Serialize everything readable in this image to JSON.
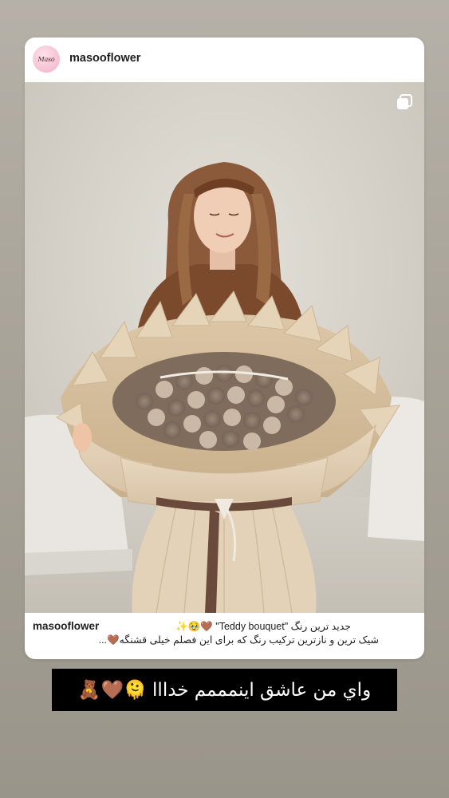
{
  "post": {
    "username": "masooflower",
    "avatar_logo": "Maso",
    "image_description": "Woman in brown shirt holding a large beige bouquet filled with teddy bears",
    "caption_user": "masooflower",
    "caption_line1": "جدید ترین رنگ \"Teddy bouquet\" 🤎🥹✨",
    "caption_line2": "شیک ترین و نازترین ترکیب رنگ که برای این فصلم خیلی قشنگه🤎..."
  },
  "sticker": {
    "text": "واي من عاشق اينمممم خدااا 🫠🤎🧸"
  },
  "colors": {
    "background": "#a8a398",
    "card": "#ffffff",
    "avatar_bg": "#f6bfd1",
    "sticker_bg": "#000000",
    "sticker_text": "#ffffff"
  },
  "icons": [
    "multiple-images-icon"
  ]
}
